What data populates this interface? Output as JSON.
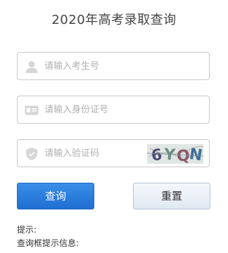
{
  "header": {
    "title": "2020年高考录取查询"
  },
  "form": {
    "exam_number": {
      "placeholder": "请输入考生号",
      "value": "",
      "icon": "user-icon"
    },
    "id_card": {
      "placeholder": "请输入身份证号",
      "value": "",
      "icon": "id-card-icon"
    },
    "captcha": {
      "placeholder": "请输入验证码",
      "value": "",
      "icon": "shield-icon",
      "image_text": "6YQN"
    }
  },
  "buttons": {
    "query_label": "查询",
    "reset_label": "重置"
  },
  "tips": {
    "title": "提示:",
    "line1": "查询框提示信息:"
  },
  "colors": {
    "primary_button": "#1e6fd2",
    "secondary_button": "#dfe8f2",
    "border": "#c9c9c9",
    "placeholder_text": "#b0b0b0",
    "icon": "#d6d6d6"
  }
}
